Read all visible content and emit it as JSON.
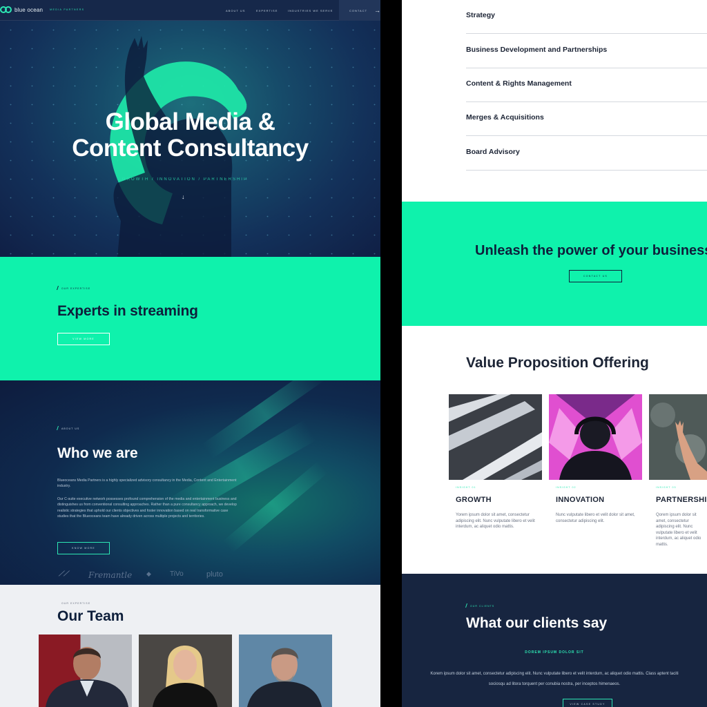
{
  "brand": {
    "name": "blue ocean",
    "tagline": "MEDIA PARTNERS"
  },
  "nav": {
    "items": [
      "ABOUT US",
      "EXPERTISE",
      "INDUSTRIES WE SERVE"
    ],
    "contact": "CONTACT"
  },
  "hero": {
    "title_line1": "Global Media &",
    "title_line2": "Content Consultancy",
    "tagline": "GROWTH / INNOVATION / PARTNERSHIP"
  },
  "expertise": {
    "eyebrow": "OUR EXPERTISE",
    "title": "Experts in  streaming",
    "button": "VIEW MORE"
  },
  "about": {
    "eyebrow": "ABOUT US",
    "title": "Who we are",
    "p1": "Blueoceans Media Partners is a highly specialized advisory consultancy in the Media, Content and Entertainment industry.",
    "p2": "Our C-suite executive network possesses profound comprehension of the media and entertainment business and distinguishes us from conventional consulting approaches. Rather than a pure consultancy approach, we develop realistic strategies that uphold our clients objectives and foster innovation based on real transformative case studies that the Blueoceans team have already driven across multiple projects and territories.",
    "button": "KNOW MORE",
    "partners": [
      "Fremantle",
      "TiVo",
      "pluto"
    ]
  },
  "team": {
    "eyebrow": "OUR EXPERTISE",
    "title": "Our Team"
  },
  "services": [
    "Strategy",
    "Business Development and Partnerships",
    "Content & Rights Management",
    "Merges & Acquisitions",
    "Board Advisory"
  ],
  "cta": {
    "title": "Unleash the power of your business",
    "button": "CONTACT US"
  },
  "value": {
    "title": "Value Proposition Offering",
    "cards": [
      {
        "tag": "INSIGHT 01",
        "title": "GROWTH",
        "text": "Yorem ipsum dolor sit amet, consectetur adipiscing elit. Nunc vulputate libero et velit interdum, ac aliquet odio mattis."
      },
      {
        "tag": "INSIGHT 02",
        "title": "INNOVATION",
        "text": "Nunc vulputate libero et velit dolor sit amet, consectetur adipiscing elit."
      },
      {
        "tag": "INSIGHT 03",
        "title": "PARTNERSHIP",
        "text": "Qorem ipsum dolor sit amet, consectetur adipiscing elit. Nunc vulputate libero et velit interdum, ac aliquet odio mattis."
      }
    ]
  },
  "clients": {
    "eyebrow": "OUR CLIENTS",
    "title": "What our clients say",
    "subtitle": "DOREM IPSUM DOLOR SIT",
    "quote": "Korem ipsum dolor sit amet, consectetur adipiscing elit. Nunc vulputate libero et velit interdum, ac aliquet odio mattis. Class aptent taciti sociosqu ad litora torquent per conubia nostra, per inceptos himenaeos.",
    "button": "VIEW CASE STUDY"
  },
  "colors": {
    "accent": "#0ff2ac",
    "navy": "#0e1f3b",
    "mint": "#2de8b4"
  }
}
